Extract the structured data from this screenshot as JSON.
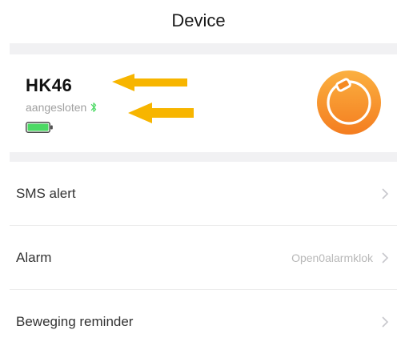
{
  "header": {
    "title": "Device"
  },
  "device": {
    "name": "HK46",
    "status": "aangesloten",
    "status_color": "#a0a0a0",
    "bluetooth_icon": "bluetooth-icon",
    "battery_icon": "battery-icon",
    "battery_color": "#4cd964",
    "badge_icon": "watch-icon",
    "badge_color": "#f7941d",
    "annotation_color": "#f7b500"
  },
  "list": {
    "items": [
      {
        "label": "SMS alert",
        "value": ""
      },
      {
        "label": "Alarm",
        "value": "Open0alarmklok"
      },
      {
        "label": "Beweging reminder",
        "value": ""
      }
    ]
  }
}
